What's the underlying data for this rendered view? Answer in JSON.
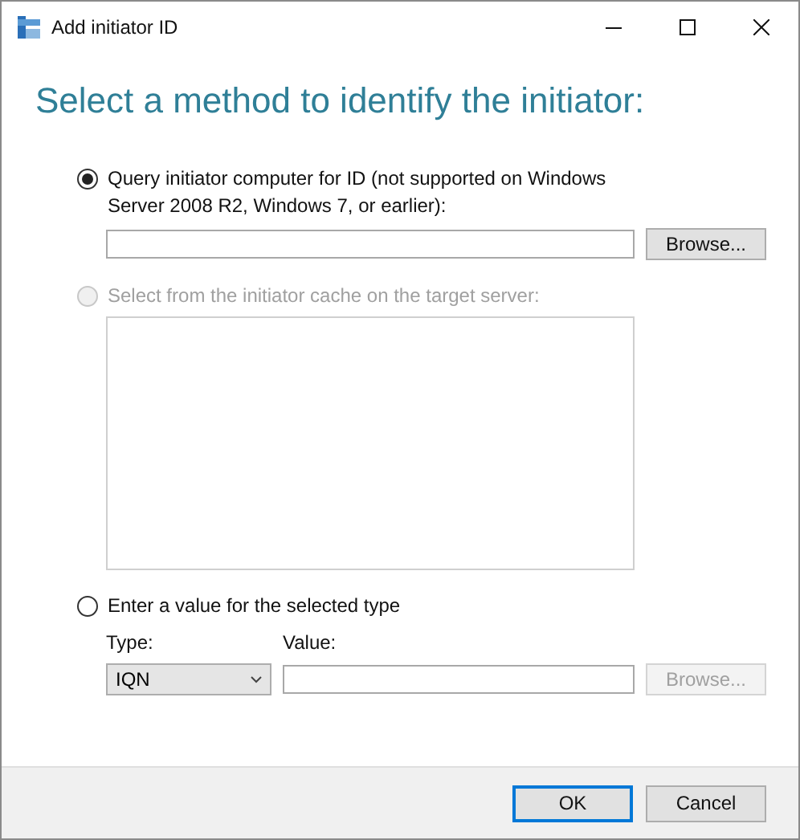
{
  "window": {
    "title": "Add initiator ID"
  },
  "heading": "Select a method to identify the initiator:",
  "options": [
    {
      "kind": "query",
      "label": "Query initiator computer for ID (not supported on Windows Server 2008 R2, Windows 7, or earlier):",
      "selected": true,
      "disabled": false,
      "browse": {
        "label": "Browse...",
        "disabled": false
      }
    },
    {
      "kind": "cache",
      "label": "Select from the initiator cache on the target server:",
      "selected": false,
      "disabled": true
    },
    {
      "kind": "value",
      "label": "Enter a value for the selected type",
      "selected": false,
      "disabled": false,
      "type_label": "Type:",
      "type_value": "IQN",
      "value_label": "Value:",
      "browse": {
        "label": "Browse...",
        "disabled": true
      }
    }
  ],
  "buttons": [
    {
      "label": "OK",
      "default": true
    },
    {
      "label": "Cancel",
      "default": false
    }
  ]
}
